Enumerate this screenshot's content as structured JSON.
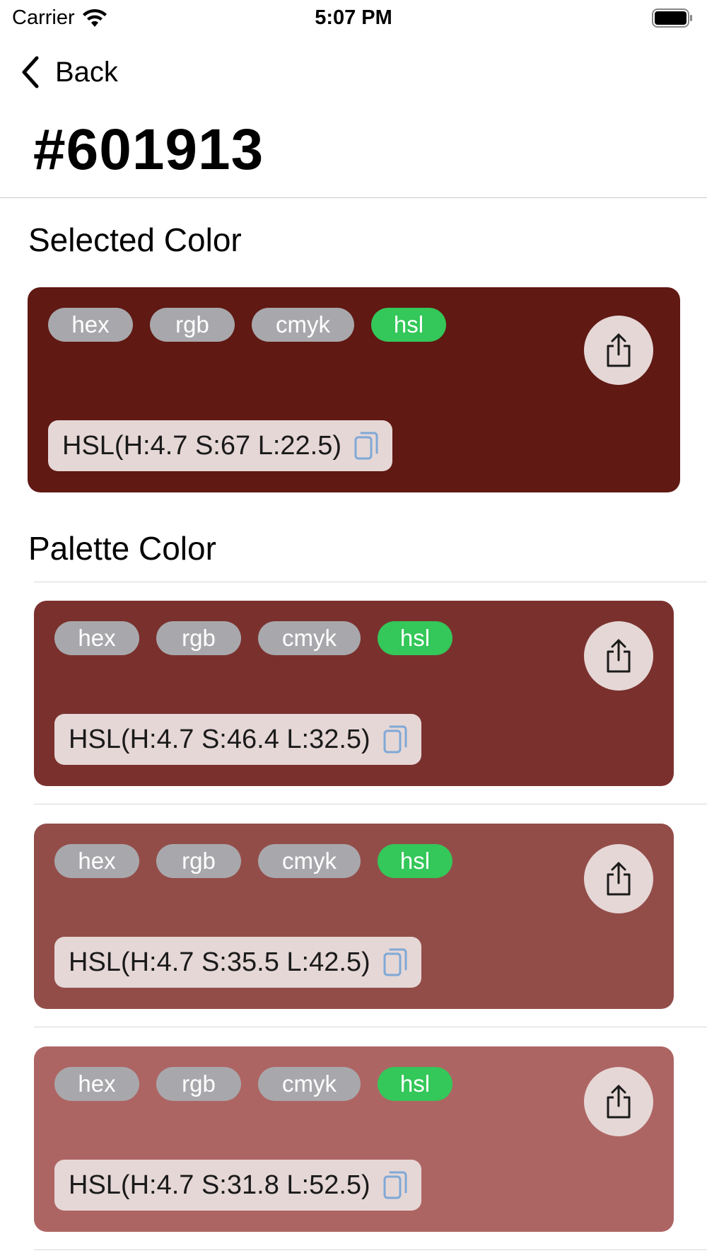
{
  "status_bar": {
    "carrier": "Carrier",
    "time": "5:07 PM",
    "icons": [
      "wifi-icon",
      "battery-icon"
    ]
  },
  "nav": {
    "back_label": "Back",
    "title": "#601913"
  },
  "sections": {
    "selected_heading": "Selected Color",
    "palette_heading": "Palette Color"
  },
  "format_chips": {
    "hex": "hex",
    "rgb": "rgb",
    "cmyk": "cmyk",
    "hsl": "hsl",
    "active": "hsl"
  },
  "selected_color": {
    "color": "#601913",
    "value": "HSL(H:4.7 S:67 L:22.5)"
  },
  "palette": [
    {
      "color": "#7a312e",
      "value": "HSL(H:4.7 S:46.4 L:32.5)"
    },
    {
      "color": "#934d49",
      "value": "HSL(H:4.7 S:35.5 L:42.5)"
    },
    {
      "color": "#ad6563",
      "value": "HSL(H:4.7 S:31.8 L:52.5)"
    }
  ],
  "colors": {
    "chip_inactive": "#a8a8ac",
    "chip_active": "#34c759",
    "pill_bg": "#e5d7d6",
    "copy_icon": "#7fa8d6"
  }
}
